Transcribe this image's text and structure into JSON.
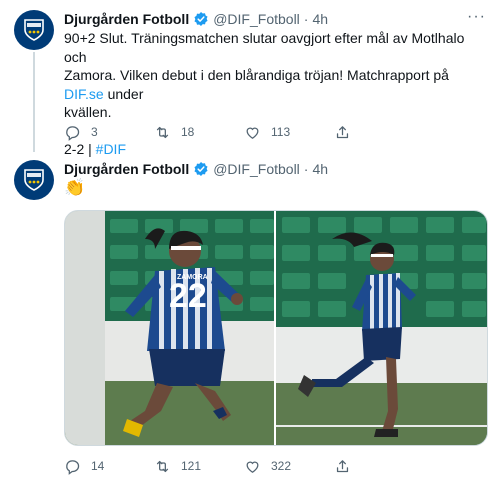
{
  "tweets": [
    {
      "author_name": "Djurgården Fotboll",
      "handle": "@DIF_Fotboll",
      "separator": "·",
      "time": "4h",
      "more": "···",
      "text_lines": [
        "90+2 Slut. Träningsmatchen slutar oavgjort efter mål av Motlhalo och",
        "Zamora. Vilken debut i den blårandiga tröjan! Matchrapport på "
      ],
      "link_text": "DIF.se",
      "after_link": " under",
      "text_line3": "kvällen.",
      "score": "2-2 | ",
      "hashtag": "#DIF",
      "replies": "3",
      "retweets": "18",
      "likes": "113"
    },
    {
      "author_name": "Djurgården Fotboll",
      "handle": "@DIF_Fotboll",
      "separator": "·",
      "time": "4h",
      "more": "···",
      "emoji": "👏",
      "photo1_jersey_number": "22",
      "photo1_jersey_name": "ZAMORA",
      "replies": "14",
      "retweets": "121",
      "likes": "322"
    }
  ],
  "icons": {
    "reply": "reply-icon",
    "retweet": "retweet-icon",
    "like": "heart-icon",
    "share": "share-icon",
    "verified": "verified-badge-icon"
  },
  "colors": {
    "accent": "#1d9bf0",
    "club_blue": "#003b77",
    "text": "#0f1419",
    "muted": "#536471"
  }
}
